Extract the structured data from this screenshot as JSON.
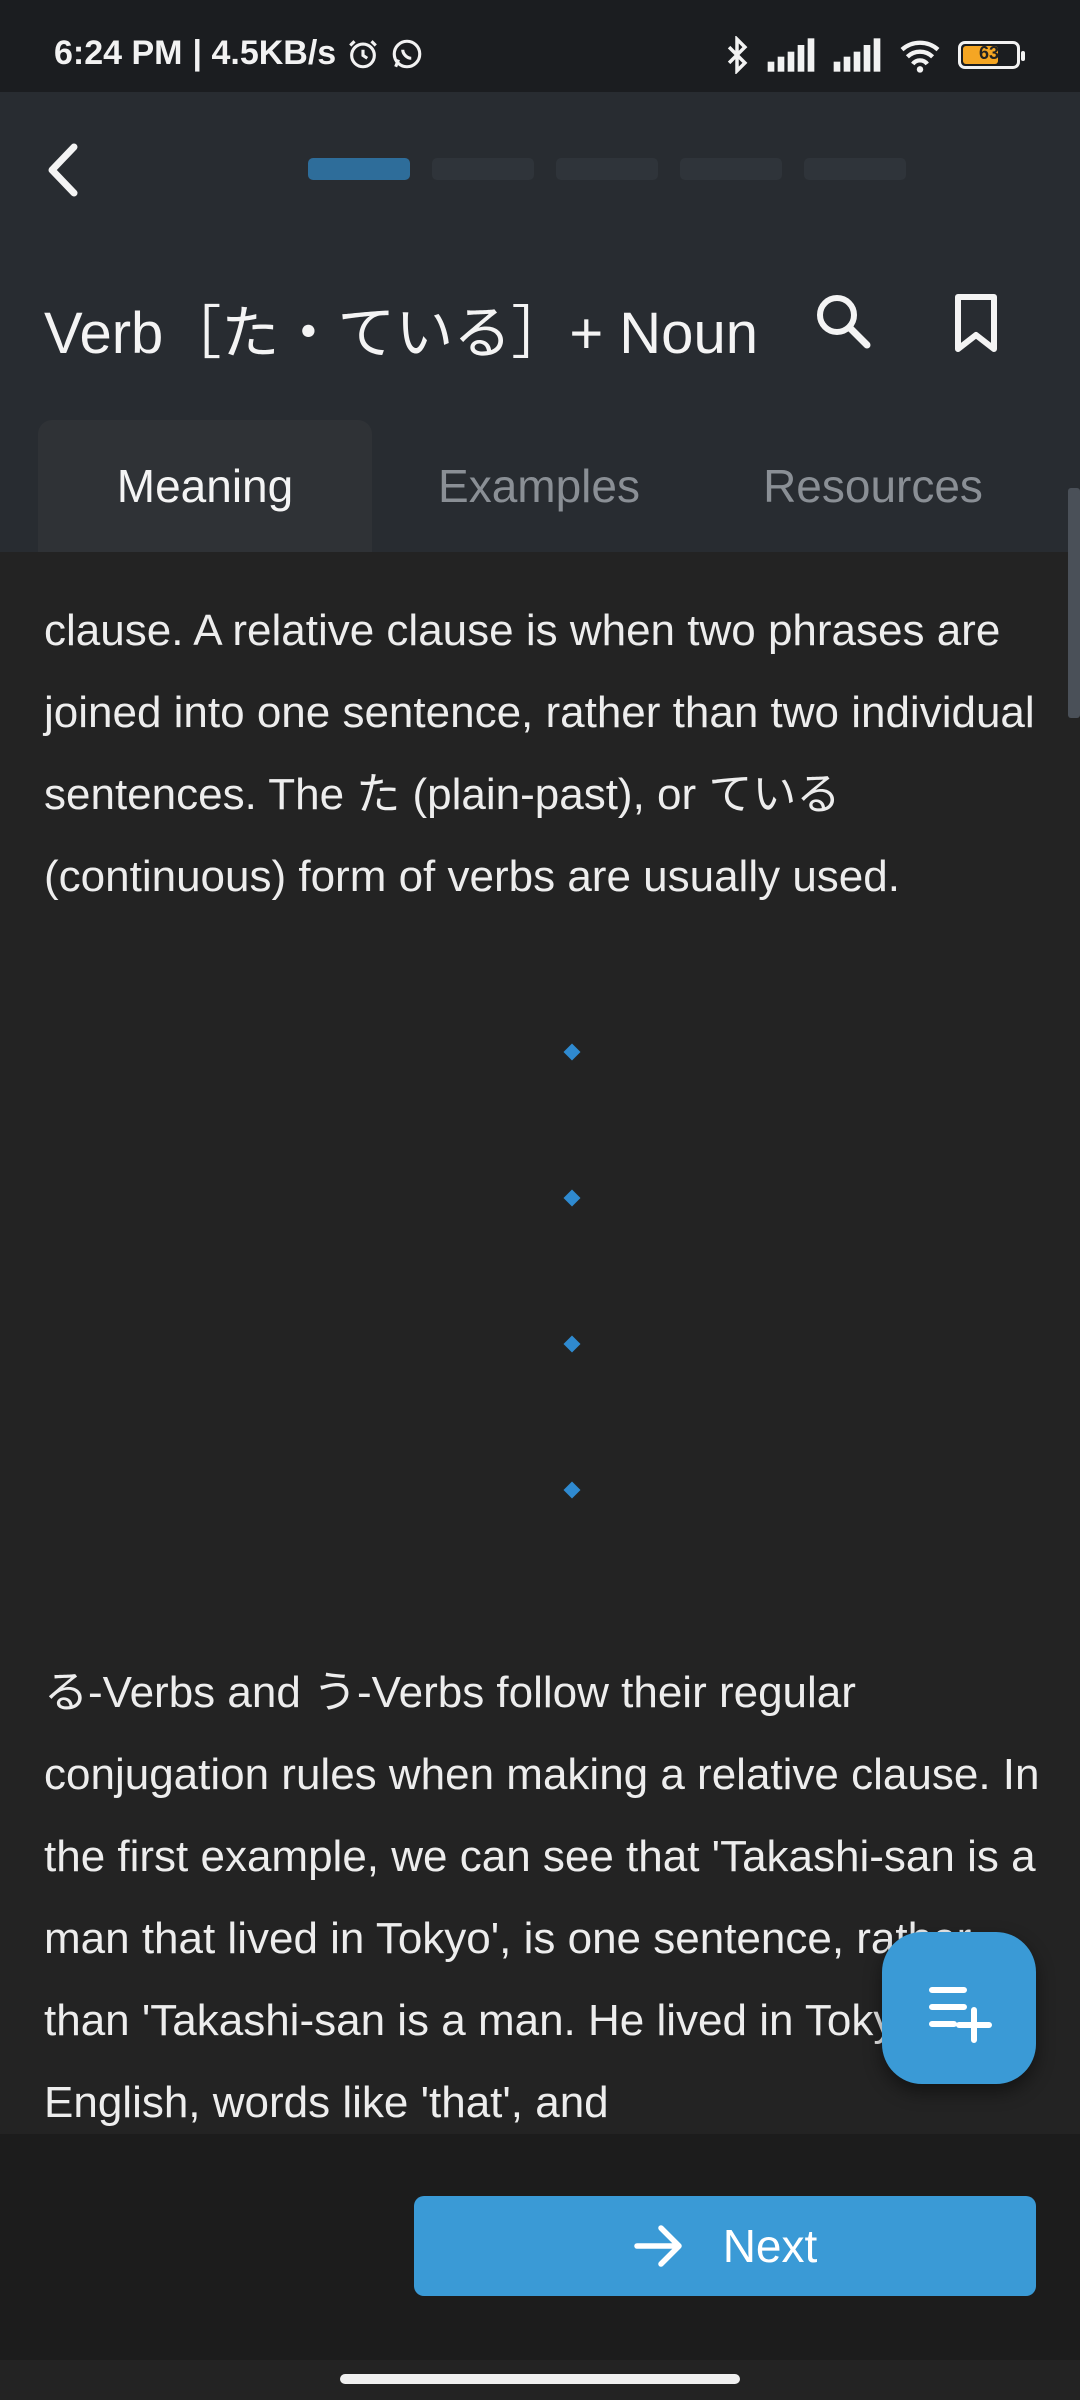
{
  "status_bar": {
    "time": "6:24 PM",
    "speed": "| 4.5KB/s",
    "battery": "63"
  },
  "header": {
    "title": "Verb［た・ている］+ Noun",
    "progress_segments": 5,
    "active_segment": 1
  },
  "tabs": [
    {
      "label": "Meaning",
      "active": true
    },
    {
      "label": "Examples",
      "active": false
    },
    {
      "label": "Resources",
      "active": false
    }
  ],
  "content": {
    "paragraph1": "clause. A relative clause is when two phrases are joined into one sentence, rather than two individual sentences. The た (plain-past), or ている (continuous) form of verbs are usually used.",
    "paragraph2": "る-Verbs and う-Verbs follow their regular conjugation rules when making a relative clause. In the first example, we can see that 'Takashi-san is a man that lived in Tokyo', is one sentence, rather than 'Takashi-san is a man. He lived in Tokyo'. In English, words like 'that', and"
  },
  "next_button": {
    "label": "Next"
  },
  "colors": {
    "accent": "#3a9ad6",
    "header_bg": "#282c31",
    "content_bg": "#232323"
  },
  "icons": [
    "back-arrow-icon",
    "search-icon",
    "bookmark-icon",
    "playlist-add-icon",
    "arrow-right-icon"
  ]
}
